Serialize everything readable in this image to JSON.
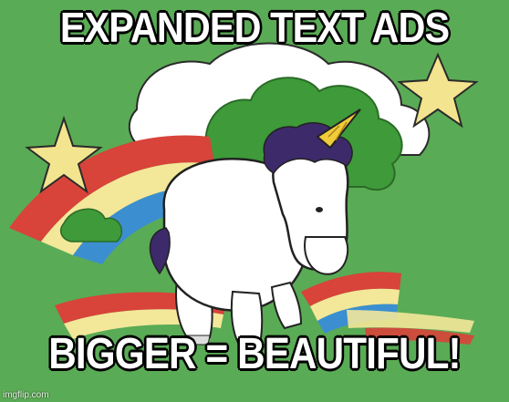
{
  "meme": {
    "top_text": "EXPANDED TEXT ADS",
    "bottom_text": "BIGGER = BEAUTIFUL!",
    "watermark": "imgflip.com"
  },
  "colors": {
    "background": "#5aab55",
    "rainbow_red": "#d8433a",
    "rainbow_yellow": "#f3e79a",
    "rainbow_blue": "#3b8fd0",
    "star": "#f3e48f",
    "unicorn_body": "#ffffff",
    "mane": "#3d2a6b",
    "horn": "#f0cc3a",
    "bush": "#3f9a3a"
  },
  "icons": [
    "star-icon",
    "rainbow-illustration",
    "unicorn-illustration",
    "cloud-illustration"
  ]
}
